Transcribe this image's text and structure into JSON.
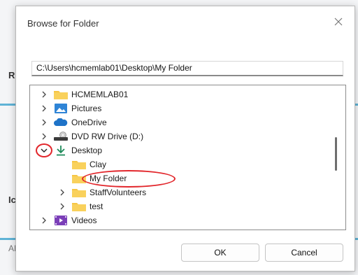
{
  "background": {
    "left_text_1": "R",
    "left_text_2": "Ic",
    "left_text_3": "AL"
  },
  "dialog": {
    "title": "Browse for Folder",
    "path": "C:\\Users\\hcmemlab01\\Desktop\\My Folder",
    "tree": [
      {
        "label": "HCMEMLAB01",
        "icon": "folder-icon",
        "expanded": false
      },
      {
        "label": "Pictures",
        "icon": "pictures-icon",
        "expanded": false
      },
      {
        "label": "OneDrive",
        "icon": "cloud-icon",
        "expanded": false
      },
      {
        "label": "DVD RW Drive (D:)",
        "icon": "dvd-drive-icon",
        "expanded": false
      },
      {
        "label": "Desktop",
        "icon": "download-arrow-icon",
        "expanded": true
      },
      {
        "label": "Clay",
        "icon": "folder-icon"
      },
      {
        "label": "My Folder",
        "icon": "folder-icon"
      },
      {
        "label": "StaffVolunteers",
        "icon": "folder-icon",
        "expanded": false
      },
      {
        "label": "test",
        "icon": "folder-icon",
        "expanded": false
      },
      {
        "label": "Videos",
        "icon": "videos-icon",
        "expanded": false
      }
    ],
    "ok_label": "OK",
    "cancel_label": "Cancel"
  },
  "colors": {
    "folder": "#f6c544",
    "annotation_red": "#e2272c",
    "accent_blue": "#1e73c8",
    "desktop_green": "#1e8a5a"
  }
}
